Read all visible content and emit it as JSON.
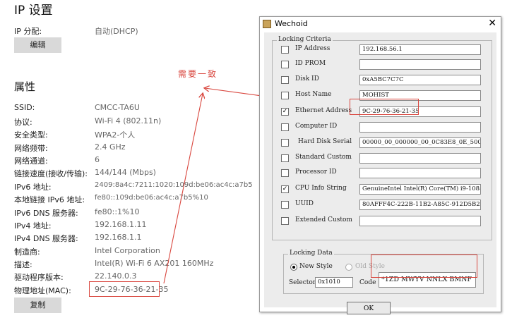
{
  "settings": {
    "title": "IP 设置",
    "ip_assign_label": "IP 分配:",
    "ip_assign_value": "自动(DHCP)",
    "edit_button": "编辑",
    "properties_title": "属性",
    "properties": [
      {
        "label": "SSID:",
        "value": "CMCC-TA6U"
      },
      {
        "label": "协议:",
        "value": "Wi-Fi 4 (802.11n)"
      },
      {
        "label": "安全类型:",
        "value": "WPA2-个人"
      },
      {
        "label": "网络频带:",
        "value": "2.4 GHz"
      },
      {
        "label": "网络通道:",
        "value": "6"
      },
      {
        "label": "链接速度(接收/传输):",
        "value": "144/144 (Mbps)"
      },
      {
        "label": "IPv6 地址:",
        "value": "2409:8a4c:7211:1020:109d:be06:ac4c:a7b5"
      },
      {
        "label": "本地链接 IPv6 地址:",
        "value": "fe80::109d:be06:ac4c:a7b5%10"
      },
      {
        "label": "IPv6 DNS 服务器:",
        "value": "fe80::1%10"
      },
      {
        "label": "IPv4 地址:",
        "value": "192.168.1.11"
      },
      {
        "label": "IPv4 DNS 服务器:",
        "value": "192.168.1.1"
      },
      {
        "label": "制造商:",
        "value": "Intel Corporation"
      },
      {
        "label": "描述:",
        "value": "Intel(R) Wi-Fi 6 AX201 160MHz"
      },
      {
        "label": "驱动程序版本:",
        "value": "22.140.0.3"
      },
      {
        "label": "物理地址(MAC):",
        "value": "9C-29-76-36-21-35"
      }
    ],
    "copy_button": "复制"
  },
  "annotation": {
    "text": "需要一致",
    "color": "#d9473f"
  },
  "dialog": {
    "title": "Wechoid",
    "close": "✕",
    "criteria_title": "Locking Criteria",
    "criteria": [
      {
        "label": "IP Address",
        "checked": false,
        "value": "192.168.56.1"
      },
      {
        "label": "ID PROM",
        "checked": false,
        "value": ""
      },
      {
        "label": "Disk ID",
        "checked": false,
        "value": "0xA5BC7C7C"
      },
      {
        "label": "Host Name",
        "checked": false,
        "value": "MOHIST"
      },
      {
        "label": "Ethernet Address",
        "checked": true,
        "value": "9C-29-76-36-21-35"
      },
      {
        "label": "Computer ID",
        "checked": false,
        "value": ""
      },
      {
        "label": "Hard Disk Serial",
        "checked": false,
        "value": "00000_00_000000_00_0C83E8_0E_500891_F"
      },
      {
        "label": "Standard Custom",
        "checked": false,
        "value": ""
      },
      {
        "label": "Processor ID",
        "checked": false,
        "value": ""
      },
      {
        "label": "CPU Info String",
        "checked": true,
        "value": "GenuineIntel Intel(R) Core(TM) i9-10885H C"
      },
      {
        "label": "UUID",
        "checked": false,
        "value": "80AFFF4C-222B-11B2-A85C-912D5B2BB42"
      },
      {
        "label": "Extended Custom",
        "checked": false,
        "value": ""
      }
    ],
    "locking_data_title": "Locking Data",
    "new_style": "New Style",
    "old_style": "Old Style",
    "selector_label": "Selector",
    "selector_value": "0x1010",
    "code_label": "Code",
    "code_value": "*1ZD MWYV NNLX BMNF",
    "ok": "OK"
  }
}
